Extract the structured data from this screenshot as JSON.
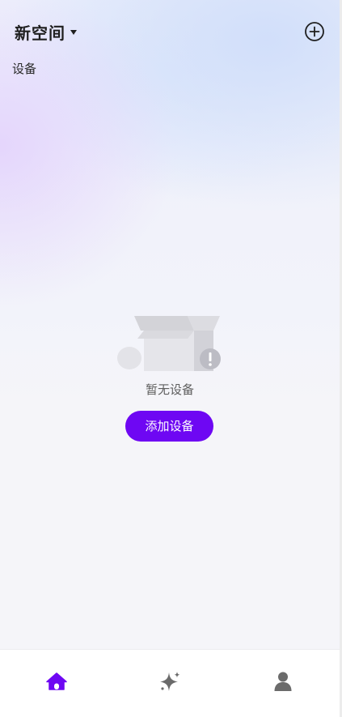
{
  "header": {
    "space_name": "新空间",
    "add_icon": "plus-circle-icon"
  },
  "section": {
    "label": "设备"
  },
  "empty_state": {
    "illustration": "empty-box-icon",
    "message": "暂无设备",
    "button_label": "添加设备"
  },
  "tab_bar": {
    "tabs": [
      {
        "icon": "home-icon",
        "active": true
      },
      {
        "icon": "sparkle-icon",
        "active": false
      },
      {
        "icon": "user-icon",
        "active": false
      }
    ]
  },
  "colors": {
    "accent": "#6e07f3",
    "icon_inactive": "#6b6b6b",
    "text_primary": "#1f1f1f",
    "text_secondary": "#5e5e5e"
  }
}
